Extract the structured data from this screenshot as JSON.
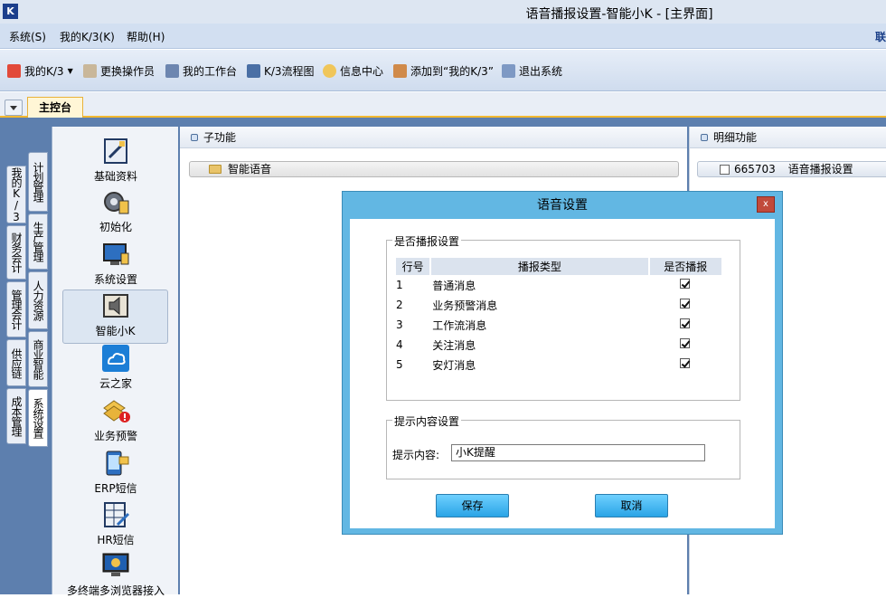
{
  "window": {
    "title": "语音播报设置-智能小K - [主界面]",
    "logo_letter": "K"
  },
  "menubar": {
    "items": [
      "系统(S)",
      "我的K/3(K)",
      "帮助(H)"
    ],
    "right_label": "联"
  },
  "toolbar": {
    "items": [
      {
        "label": "我的K/3",
        "icon": "star-icon"
      },
      {
        "label": "更换操作员",
        "icon": "users-icon"
      },
      {
        "label": "我的工作台",
        "icon": "pencil-icon"
      },
      {
        "label": "K/3流程图",
        "icon": "flowchart-icon"
      },
      {
        "label": "信息中心",
        "icon": "message-icon"
      },
      {
        "label": "添加到“我的K/3”",
        "icon": "add-favorite-icon"
      },
      {
        "label": "退出系统",
        "icon": "exit-icon"
      }
    ]
  },
  "tabs": {
    "active": "主控台"
  },
  "left_vtabs": {
    "outer": [
      "我的K/3",
      "财务会计",
      "管理会计",
      "供应链",
      "成本管理"
    ],
    "inner": [
      "计划管理",
      "生产管理",
      "人力资源",
      "商业智能",
      "系统设置"
    ]
  },
  "nav": {
    "items": [
      {
        "label": "基础资料",
        "icon": "basic-data-icon"
      },
      {
        "label": "初始化",
        "icon": "gear-icon"
      },
      {
        "label": "系统设置",
        "icon": "monitor-icon"
      },
      {
        "label": "智能小K",
        "icon": "speaker-icon"
      },
      {
        "label": "云之家",
        "icon": "cloud-icon"
      },
      {
        "label": "业务预警",
        "icon": "warning-icon"
      },
      {
        "label": "ERP短信",
        "icon": "sms-icon"
      },
      {
        "label": "HR短信",
        "icon": "hr-sms-icon"
      },
      {
        "label": "多终端多浏览器接入",
        "icon": "terminal-icon"
      }
    ]
  },
  "subfunc": {
    "header": "子功能",
    "folder_label": "智能语音"
  },
  "detail": {
    "header": "明细功能",
    "row_code": "665703",
    "row_label": "语音播报设置"
  },
  "dialog": {
    "title": "语音设置",
    "close_label": "x",
    "broadcast_group": {
      "legend": "是否播报设置",
      "columns": [
        "行号",
        "播报类型",
        "是否播报"
      ],
      "rows": [
        {
          "no": "1",
          "type": "普通消息",
          "checked": true
        },
        {
          "no": "2",
          "type": "业务预警消息",
          "checked": true
        },
        {
          "no": "3",
          "type": "工作流消息",
          "checked": true
        },
        {
          "no": "4",
          "type": "关注消息",
          "checked": true
        },
        {
          "no": "5",
          "type": "安灯消息",
          "checked": true
        }
      ]
    },
    "content_group": {
      "legend": "提示内容设置",
      "label": "提示内容:",
      "value": "小K提醒"
    },
    "save_label": "保存",
    "cancel_label": "取消"
  },
  "colors": {
    "accent_orange": "#f2b830",
    "dialog_frame": "#62b7e3",
    "button_blue": "#2aa4e6"
  }
}
